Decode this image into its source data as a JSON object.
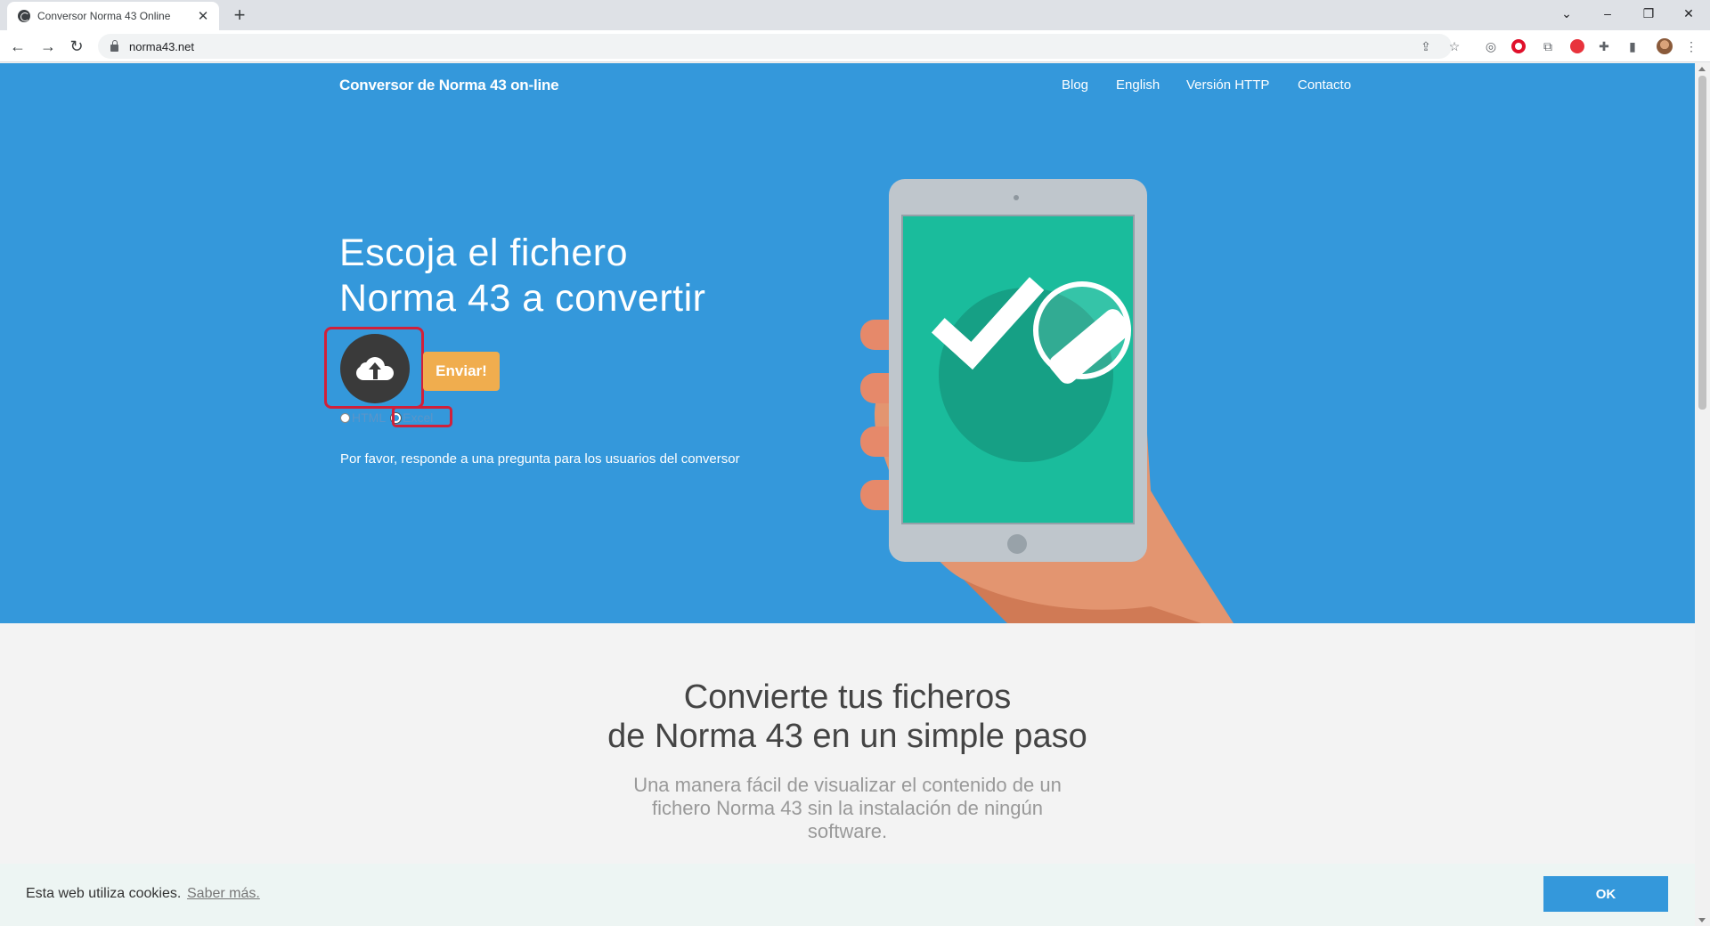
{
  "browser": {
    "tab_title": "Conversor Norma 43 Online",
    "tab_close": "✕",
    "new_tab": "+",
    "url": "norma43.net",
    "window_controls": {
      "tab_search": "⌄",
      "minimize": "–",
      "restore": "❐",
      "close": "✕"
    },
    "nav": {
      "back": "←",
      "forward": "→",
      "reload": "↻"
    },
    "toolbar_icons": {
      "share": "⇪",
      "bookmark": "☆",
      "camera": "◎",
      "extension": "⧉",
      "puzzle": "✚",
      "sidebar": "▮",
      "menu": "⋮"
    }
  },
  "header": {
    "brand": "Conversor de Norma 43 on-line",
    "nav_items": [
      "Blog",
      "English",
      "Versión HTTP",
      "Contacto"
    ]
  },
  "hero": {
    "heading_line1": "Escoja el fichero",
    "heading_line2": "Norma 43 a convertir",
    "upload_icon": "cloud-upload-icon",
    "send_label": "Enviar!",
    "format_options": [
      {
        "label": "HTML",
        "selected": false
      },
      {
        "label": "Excel",
        "selected": true
      }
    ],
    "question": "Por favor, responde a una pregunta para los usuarios del conversor"
  },
  "section": {
    "title_line1": "Convierte tus ficheros",
    "title_line2": "de Norma 43 en un simple paso",
    "sub_line1": "Una manera fácil de visualizar el contenido de un",
    "sub_line2": "fichero Norma 43 sin la instalación de ningún",
    "sub_line3": "software."
  },
  "cookie": {
    "text": "Esta web utiliza cookies.",
    "link": "Saber más.",
    "ok": "OK"
  },
  "colors": {
    "hero_bg": "#3498db",
    "send_button": "#f0ad4e",
    "highlight": "#d1203a",
    "tablet_screen": "#1abc9c"
  }
}
